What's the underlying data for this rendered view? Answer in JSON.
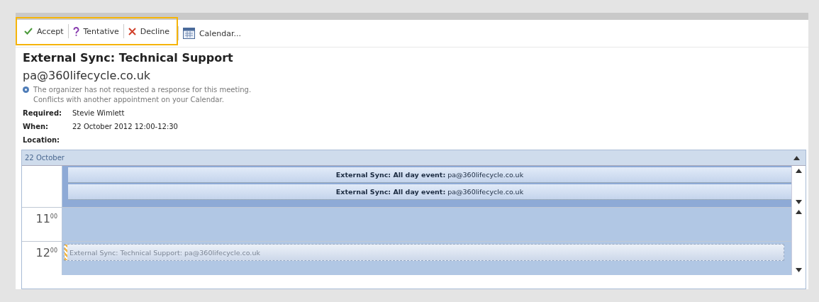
{
  "toolbar": {
    "response_group_highlighted": true,
    "buttons": [
      {
        "kind": "accept",
        "label": "Accept"
      },
      {
        "kind": "tentative",
        "label": "Tentative"
      },
      {
        "kind": "decline",
        "label": "Decline"
      },
      {
        "kind": "calendar",
        "label": "Calendar..."
      }
    ]
  },
  "meeting": {
    "title": "External Sync: Technical Support",
    "organizer": "pa@360lifecycle.co.uk",
    "info": [
      "The organizer has not requested a response for this meeting.",
      "Conflicts with another appointment on your Calendar."
    ],
    "fields": [
      {
        "label": "Required:",
        "value": "Stevie Wimlett"
      },
      {
        "label": "When:",
        "value": "22 October 2012 12:00-12:30"
      },
      {
        "label": "Location:"
      }
    ]
  },
  "calendar": {
    "date": "22 October",
    "all_day_events": [
      "**External Sync: All day event:** pa@360lifecycle.co.uk",
      "**External Sync: All day event:** pa@360lifecycle.co.uk"
    ],
    "hours": [
      {
        "label": "11$^{00}$"
      },
      {
        "label": "12$^{00}$",
        "appointment": {
          "text": "External Sync: Technical Support: pa@360lifecycle.co.uk",
          "tentative": true
        }
      }
    ]
  }
}
